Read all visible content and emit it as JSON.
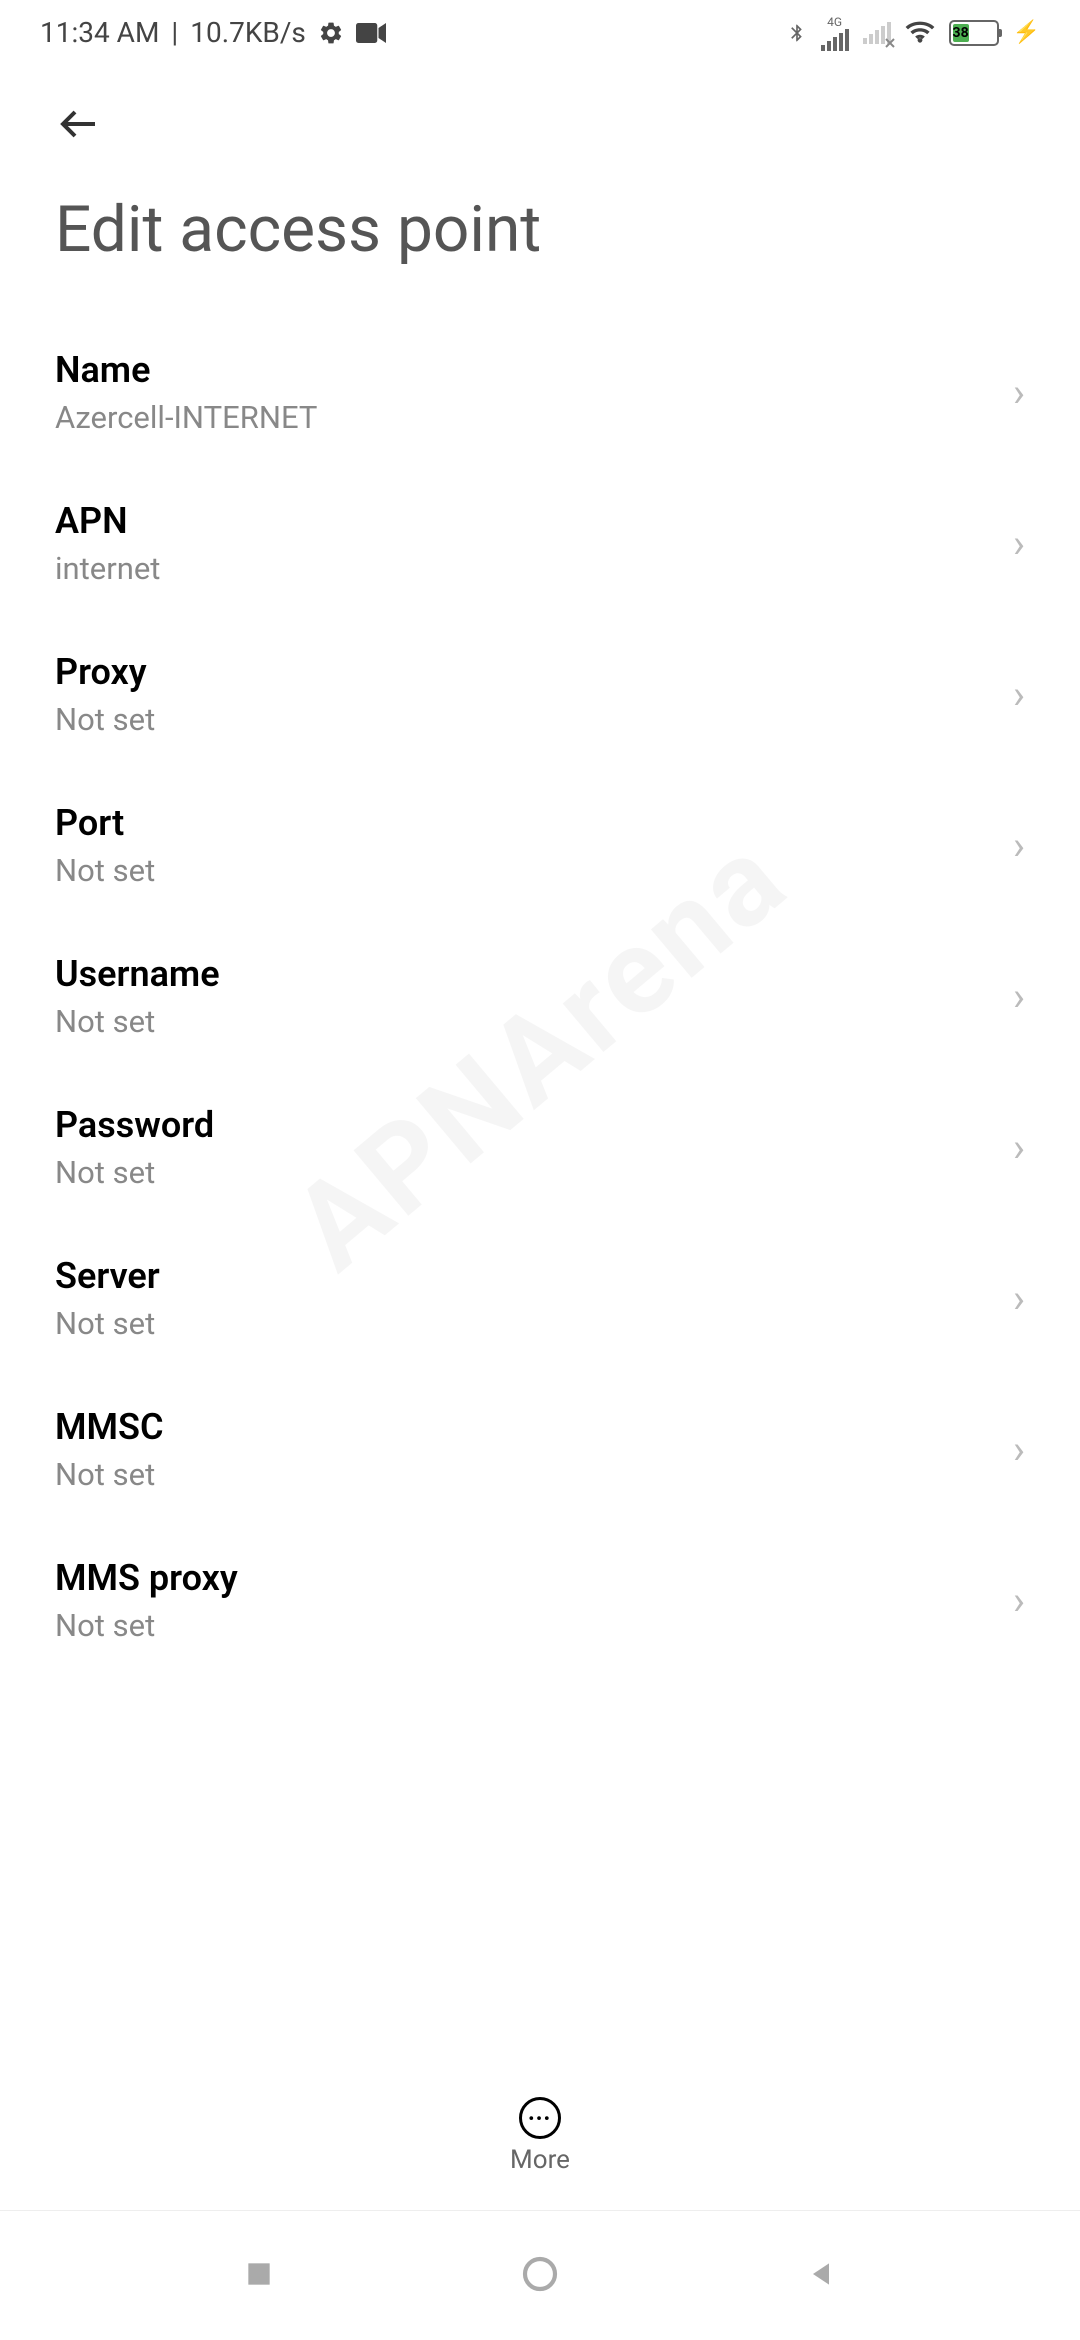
{
  "status_bar": {
    "time": "11:34 AM",
    "data_rate": "10.7KB/s",
    "network_label": "4G",
    "battery_percent": "38"
  },
  "header": {
    "title": "Edit access point"
  },
  "settings": [
    {
      "label": "Name",
      "value": "Azercell-INTERNET"
    },
    {
      "label": "APN",
      "value": "internet"
    },
    {
      "label": "Proxy",
      "value": "Not set"
    },
    {
      "label": "Port",
      "value": "Not set"
    },
    {
      "label": "Username",
      "value": "Not set"
    },
    {
      "label": "Password",
      "value": "Not set"
    },
    {
      "label": "Server",
      "value": "Not set"
    },
    {
      "label": "MMSC",
      "value": "Not set"
    },
    {
      "label": "MMS proxy",
      "value": "Not set"
    }
  ],
  "bottom_action": {
    "label": "More"
  },
  "watermark": "APNArena"
}
